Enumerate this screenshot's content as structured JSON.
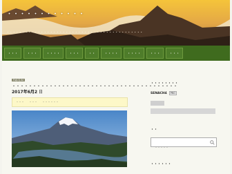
{
  "header": {
    "site_title": "・・・・・・・・・・・・",
    "site_description": "・・・・・・・・・・・・・・・・・・・・・・・・・・・・・・・・・・・・・・・・・・・・"
  },
  "nav": {
    "items": [
      "・・・",
      "・・・",
      "・・・・",
      "・・・",
      "・・",
      "・・・・",
      "・・・・",
      "・・・",
      "・・・"
    ]
  },
  "article": {
    "category": "Fuji-Q Ar",
    "title": "・・・・・・・・・・・・・・・・・・・・・・・・・・・・・・・・・・・・・・・・",
    "date": "2017年6月2",
    "title_suffix": "日",
    "meta": [
      "・・・",
      "・・・",
      "・・・・・・"
    ]
  },
  "sidebar": {
    "profile_title": "・・・・・・・・",
    "profile_name": "SENACH4",
    "profile_badge": "PRO",
    "widget2_title": "・・",
    "search_placeholder": "・・・・・",
    "widget3_title": "・・・・・・"
  },
  "colors": {
    "nav_bg": "#3f6b1e",
    "meta_bg": "#fdf8c8",
    "page_bg": "#f7f7f0"
  }
}
